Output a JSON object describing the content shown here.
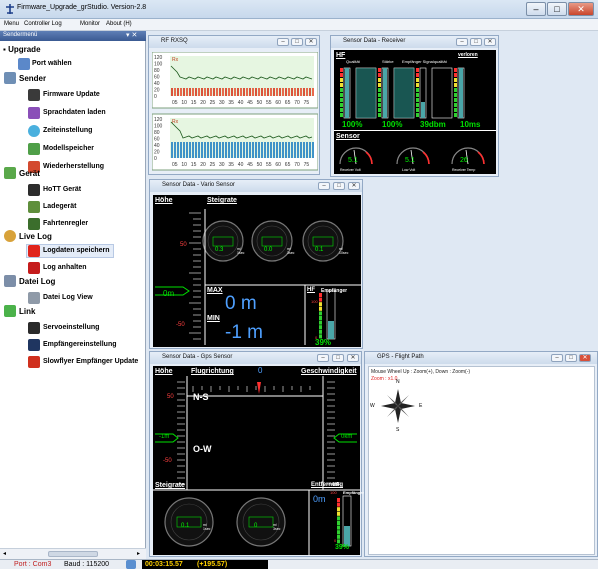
{
  "window": {
    "title": "Firmware_Upgrade_grStudio.  Version-2.8",
    "controls": [
      "–",
      "□",
      "✕"
    ]
  },
  "menu": [
    "Menu",
    "Controller Log",
    "Monitor",
    "About (H)"
  ],
  "sidebar": {
    "header": "Sendermenü",
    "sections": [
      {
        "title": "Upgrade",
        "items": [
          "Port wählen"
        ]
      },
      {
        "title": "Sender",
        "items": [
          "Firmware Update",
          "Sprachdaten laden",
          "Zeiteinstellung",
          "Modellspeicher",
          "Wiederherstellung"
        ]
      },
      {
        "title": "Gerät",
        "items": [
          "HoTT Gerät",
          "Ladegerät",
          "Fahrtenregler"
        ]
      },
      {
        "title": "Live Log",
        "items": [
          "Logdaten speichern",
          "Log anhalten"
        ]
      },
      {
        "title": "Datei Log",
        "items": [
          "Datei Log View"
        ]
      },
      {
        "title": "Link",
        "items": [
          "Servoeinstellung",
          "Empfängereinstellung",
          "Slowflyer Empfänger Update"
        ]
      }
    ]
  },
  "rf_rxsq": {
    "title": "RF RXSQ",
    "y_ticks": [
      "120",
      "100",
      "80",
      "60",
      "40",
      "20",
      "0"
    ],
    "x_ticks": [
      "05",
      "10",
      "15",
      "20",
      "25",
      "30",
      "35",
      "40",
      "45",
      "50",
      "55",
      "60",
      "65",
      "70",
      "75"
    ],
    "tag": "Rx"
  },
  "receiver": {
    "title": "Sensor Data - Receiver",
    "hf_label": "HF",
    "columns": [
      "Qualität",
      "Stärke",
      "Empfänger Signalqualität",
      "verloren"
    ],
    "values": [
      "100%",
      "100%",
      "39dbm",
      "10ms"
    ],
    "sensor_label": "Sensor",
    "gauges": [
      {
        "value": "5.1",
        "label": "Receiver Volt"
      },
      {
        "value": "5.1",
        "label": "Low Volt"
      },
      {
        "value": "26",
        "label": "Receiver Temp"
      }
    ]
  },
  "vario": {
    "title": "Sensor Data - Vario Sensor",
    "hoehe": "Höhe",
    "steigrate": "Steigrate",
    "scale": [
      "50",
      "-50"
    ],
    "dial_values": [
      "0.3",
      "0.0",
      "0.1"
    ],
    "dial_units": [
      "m/ 1sec",
      "m/ 3sec",
      "m/ 10sec"
    ],
    "altitude": "0m",
    "max_label": "MAX",
    "max_value": "0 m",
    "min_label": "MIN",
    "min_value": "-1 m",
    "hf_label": "HF",
    "empfaenger": "Empfänger",
    "bar_scale": [
      "100",
      "0"
    ],
    "percent": "39%"
  },
  "gps": {
    "title": "Sensor Data - Gps Sensor",
    "hoehe": "Höhe",
    "flugrichtung": "Flugrichtung",
    "compass_value": "0",
    "geschwindigkeit": "Geschwindigkeit",
    "ns": "N-S",
    "ow": "O-W",
    "scale": [
      "50",
      "-50"
    ],
    "altitude": "-1m",
    "speed": "0km",
    "steigrate": "Steigrate",
    "dial_values": [
      "0.1",
      "0"
    ],
    "dial_units": [
      "m/ 1sec",
      "m/ 3sec"
    ],
    "entfernung": "Entfernung",
    "distance": "0m",
    "hf_label": "HF",
    "empfaenger": "Empfänger",
    "bar_scale": [
      "100",
      "0"
    ],
    "percent": "39%"
  },
  "flight_path": {
    "title": "GPS - Flight Path",
    "hint": "Mouse Wheel Up : Zoom(+),  Down : Zoom(-)",
    "zoom": "Zoom : x1.0",
    "compass": [
      "N",
      "E",
      "S",
      "W"
    ]
  },
  "status": {
    "port": "Port : Com3",
    "baud": "Baud : 115200",
    "time": "00:03:15.57",
    "delta": "(+195.57)"
  },
  "colors": {
    "accent_green": "#00e000",
    "gauge_text": "#00ff00",
    "warn_red": "#ff0000",
    "bar_teal": "#4aa6a8"
  }
}
